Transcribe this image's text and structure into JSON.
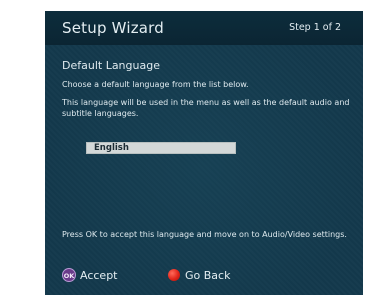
{
  "header": {
    "title": "Setup Wizard",
    "step": "Step 1 of 2"
  },
  "content": {
    "section_title": "Default Language",
    "instruction": "Choose a default language from the list below.",
    "explanation": "This language will be used in the menu as well as the default audio and subtitle languages.",
    "selected_language": "English",
    "footer_note": "Press OK to accept this language and move on to Audio/Video settings."
  },
  "actions": {
    "ok_icon_text": "OK",
    "accept_label": "Accept",
    "back_label": "Go Back",
    "ok_color": "#6a3a8a",
    "back_color": "#e0251a"
  },
  "colors": {
    "background": "#13394c",
    "header": "#0d2d3c",
    "text": "#e4eef2",
    "selection": "#d3d8d8"
  }
}
